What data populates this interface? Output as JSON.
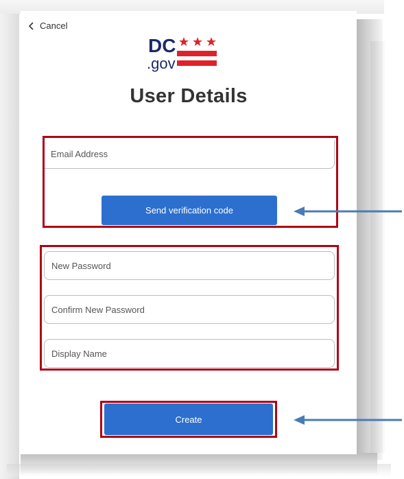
{
  "header": {
    "cancel_label": "Cancel",
    "logo_text_dc": "DC",
    "logo_text_gov": ".gov",
    "title": "User Details"
  },
  "form": {
    "email_placeholder": "Email Address",
    "send_code_label": "Send verification code",
    "new_password_placeholder": "New Password",
    "confirm_password_placeholder": "Confirm New Password",
    "display_name_placeholder": "Display Name",
    "create_label": "Create"
  },
  "icons": {
    "back": "chevron-left-icon",
    "logo": "dc-gov-logo",
    "annotation_arrow": "arrow-left-icon"
  },
  "colors": {
    "primary_button": "#2d6fce",
    "highlight_border": "#b00012",
    "arrow": "#4a7bb7",
    "logo_red": "#e0212a",
    "logo_navy": "#1b2a6b"
  }
}
